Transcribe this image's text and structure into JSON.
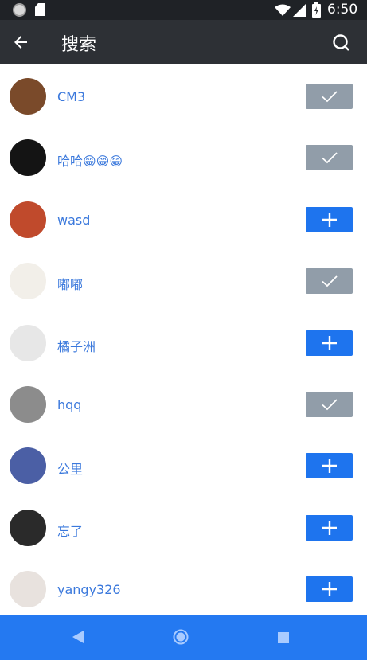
{
  "status_bar": {
    "time": "6:50"
  },
  "app_bar": {
    "title": "搜索"
  },
  "users": [
    {
      "name": "CM3",
      "followed": true,
      "avatar_color": "#7a4a2a"
    },
    {
      "name": "哈哈😁😁😁",
      "followed": true,
      "avatar_color": "#141414"
    },
    {
      "name": "wasd",
      "followed": false,
      "avatar_color": "#c04a2c"
    },
    {
      "name": "嘟嘟",
      "followed": true,
      "avatar_color": "#f2efe9"
    },
    {
      "name": "橘子洲",
      "followed": false,
      "avatar_color": "#e7e7e7"
    },
    {
      "name": "hqq",
      "followed": true,
      "avatar_color": "#8c8c8c"
    },
    {
      "name": "公里",
      "followed": false,
      "avatar_color": "#4b5fa5"
    },
    {
      "name": "忘了",
      "followed": false,
      "avatar_color": "#2a2a2a"
    },
    {
      "name": "yangy326",
      "followed": false,
      "avatar_color": "#e8e2de"
    }
  ],
  "colors": {
    "accent": "#1e74ee",
    "followed_button": "#919da9",
    "name_text": "#3a78dc",
    "app_bar": "#2d3035",
    "nav_bar": "#2479f1"
  }
}
